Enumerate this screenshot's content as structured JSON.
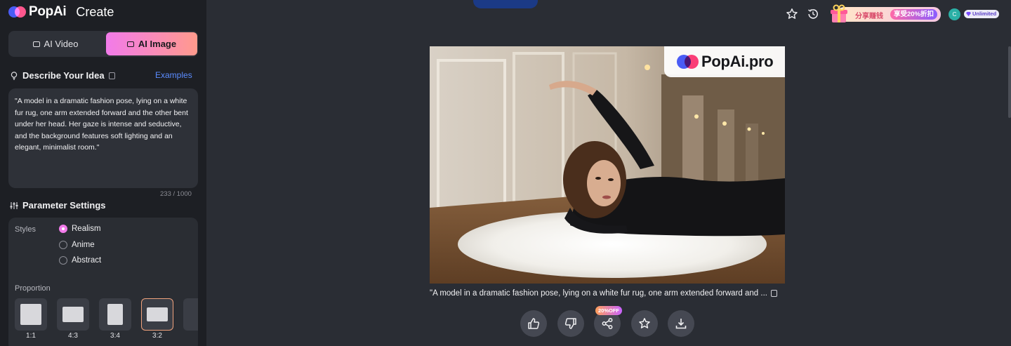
{
  "app": {
    "brand": "PopAi",
    "section": "Create"
  },
  "mode_toggle": {
    "video_label": "AI Video",
    "image_label": "AI Image",
    "selected": "AI Image"
  },
  "describe": {
    "title": "Describe Your Idea",
    "examples_label": "Examples",
    "prompt": "\"A model in a dramatic fashion pose, lying on a white fur rug, one arm extended forward and the other bent under her head. Her gaze is intense and seductive, and the background features soft lighting and an elegant, minimalist room.\"",
    "char_count": "233 / 1000"
  },
  "parameters": {
    "title": "Parameter Settings",
    "styles_label": "Styles",
    "styles": [
      "Realism",
      "Anime",
      "Abstract"
    ],
    "selected_style": "Realism",
    "proportion_label": "Proportion",
    "proportions": [
      "1:1",
      "4:3",
      "3:4",
      "3:2"
    ],
    "selected_proportion": "3:2"
  },
  "header": {
    "promo_text": "分享赚钱",
    "promo_tag": "享受20%折扣",
    "avatar_initial": "C",
    "plan": "Unlimited",
    "icons": [
      "star-icon",
      "history-icon",
      "gift-icon"
    ]
  },
  "result": {
    "watermark": "PopAi.pro",
    "caption": "\"A model in a dramatic fashion pose, lying on a white fur rug, one arm extended forward and ...",
    "share_badge": "20%OFF",
    "actions": [
      "thumbs-up-icon",
      "thumbs-down-icon",
      "share-icon",
      "star-icon",
      "download-icon"
    ]
  },
  "colors": {
    "accent_gradient_start": "#f27bea",
    "accent_gradient_end": "#ff9a8c",
    "link": "#5b8cff",
    "background": "#2a2d34",
    "sidebar": "#1d1f24"
  }
}
